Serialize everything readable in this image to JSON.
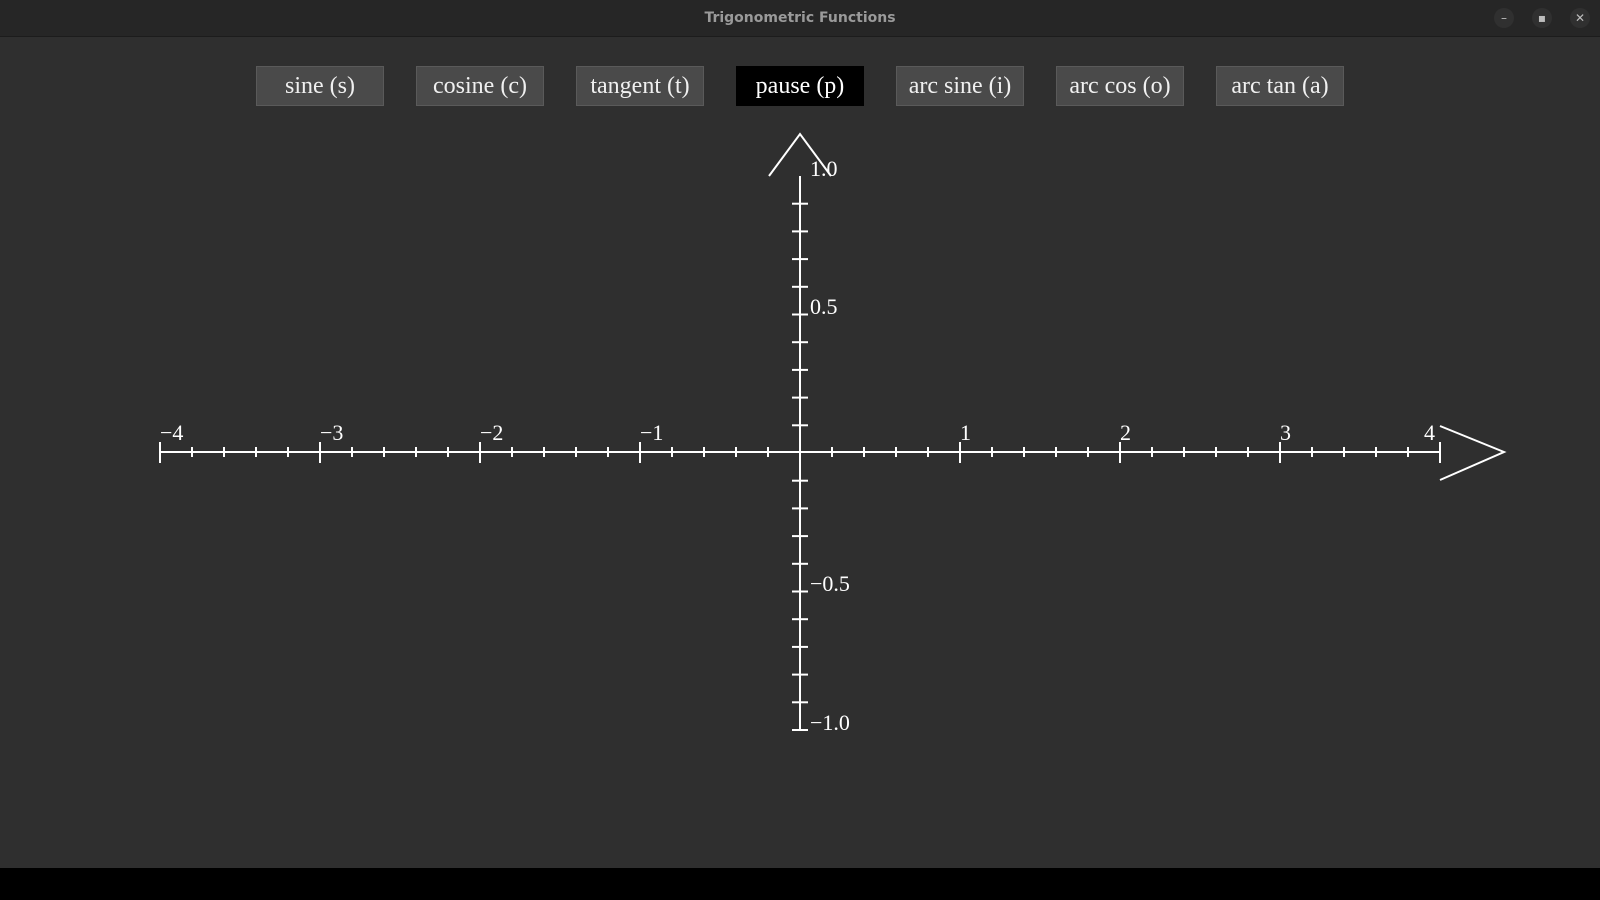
{
  "window": {
    "title": "Trigonometric Functions",
    "controls": [
      "minimize-icon",
      "maximize-icon",
      "close-icon"
    ]
  },
  "buttons": [
    {
      "label": "sine (s)",
      "active": false
    },
    {
      "label": "cosine (c)",
      "active": false
    },
    {
      "label": "tangent (t)",
      "active": false
    },
    {
      "label": "pause (p)",
      "active": true
    },
    {
      "label": "arc sine (i)",
      "active": false
    },
    {
      "label": "arc cos (o)",
      "active": false
    },
    {
      "label": "arc tan (a)",
      "active": false
    }
  ],
  "plot": {
    "x_ticks": [
      "−4",
      "−3",
      "−2",
      "−1",
      "1",
      "2",
      "3",
      "4"
    ],
    "y_ticks": [
      "1.0",
      "0.5",
      "−0.5",
      "−1.0"
    ],
    "colors": {
      "axes": "#ffffff",
      "background": "#2f2f2f"
    }
  }
}
